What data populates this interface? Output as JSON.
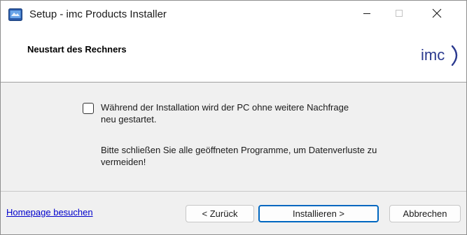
{
  "window": {
    "title": "Setup - imc Products Installer",
    "icons": {
      "app": "installer-app-icon",
      "minimize": "minimize-icon",
      "maximize": "maximize-icon",
      "close": "close-icon"
    }
  },
  "header": {
    "title": "Neustart des Rechners",
    "logo_text": "imc",
    "logo_color": "#2b3a8f"
  },
  "main": {
    "restart_checkbox_checked": false,
    "restart_text_line1": "Während der Installation wird der PC ohne weitere Nachfrage",
    "restart_text_line2": "neu gestartet.",
    "close_programs_line1": "Bitte schließen Sie alle geöffneten Programme, um Datenverluste zu",
    "close_programs_line2": "vermeiden!"
  },
  "footer": {
    "homepage_link": "Homepage besuchen",
    "back_button": "< Zurück",
    "install_button": "Installieren >",
    "cancel_button": "Abbrechen",
    "accent_color": "#0067c0",
    "link_color": "#0000cc"
  }
}
